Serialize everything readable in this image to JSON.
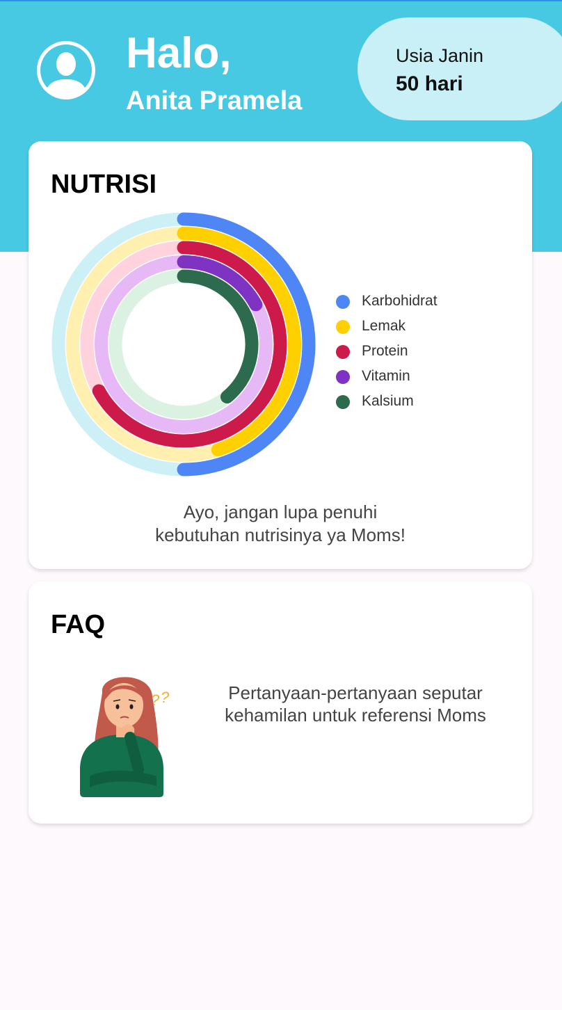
{
  "header": {
    "greeting": "Halo,",
    "user_name": "Anita Pramela",
    "fetal_age_label": "Usia Janin",
    "fetal_age_value": "50 hari"
  },
  "nutrition": {
    "title": "NUTRISI",
    "tagline_line1": "Ayo, jangan lupa penuhi",
    "tagline_line2": "kebutuhan nutrisinya ya Moms!"
  },
  "chart_data": {
    "type": "radial-bar",
    "series": [
      {
        "name": "Karbohidrat",
        "fraction": 0.5,
        "color": "#4e86f5",
        "track_color": "#cdeff6"
      },
      {
        "name": "Lemak",
        "fraction": 0.45,
        "color": "#ffd000",
        "track_color": "#fff0b0"
      },
      {
        "name": "Protein",
        "fraction": 0.67,
        "color": "#cc1a4a",
        "track_color": "#ffd2de"
      },
      {
        "name": "Vitamin",
        "fraction": 0.17,
        "color": "#7e33c2",
        "track_color": "#e6b9f6"
      },
      {
        "name": "Kalsium",
        "fraction": 0.39,
        "color": "#2c6b4e",
        "track_color": "#dbf2e2"
      }
    ]
  },
  "faq": {
    "title": "FAQ",
    "description_line1": "Pertanyaan-pertanyaan seputar",
    "description_line2": "kehamilan untuk referensi Moms",
    "illustration": "confused-woman-illustration"
  },
  "icons": {
    "avatar": "user-avatar-icon"
  }
}
